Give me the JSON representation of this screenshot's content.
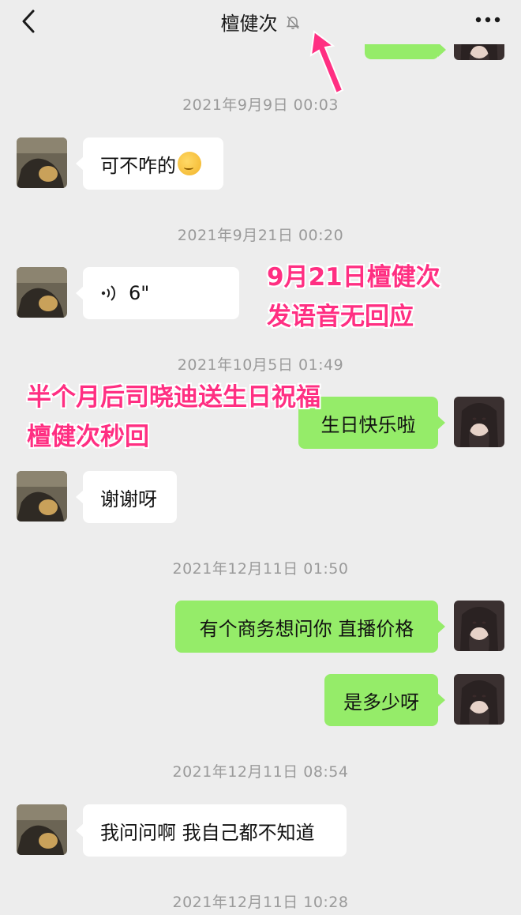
{
  "header": {
    "title": "檀健次",
    "back_icon": "chevron-left-icon",
    "mute_icon": "bell-off-icon",
    "more_icon": "ellipsis-icon"
  },
  "timestamps": [
    "2021年9月9日 00:03",
    "2021年9月21日 00:20",
    "2021年10月5日 01:49",
    "2021年12月11日 01:50",
    "2021年12月11日 08:54",
    "2021年12月11日 10:28"
  ],
  "messages": [
    {
      "from": "contact",
      "text": "可不咋的",
      "emoji": "thinking-face-icon"
    },
    {
      "from": "contact",
      "type": "voice",
      "duration": "6\""
    },
    {
      "from": "me",
      "text": "生日快乐啦"
    },
    {
      "from": "contact",
      "text": "谢谢呀"
    },
    {
      "from": "me",
      "text": "有个商务想问你 直播价格"
    },
    {
      "from": "me",
      "text": "是多少呀"
    },
    {
      "from": "contact",
      "text": "我问问啊 我自己都不知道"
    }
  ],
  "annotations": {
    "voice_note": [
      "9月21日檀健次",
      "发语音无回应"
    ],
    "birthday_note": [
      "半个月后司晓迪送生日祝福",
      "檀健次秒回"
    ]
  },
  "colors": {
    "background": "#ededed",
    "outgoing_bubble": "#95ec69",
    "incoming_bubble": "#ffffff",
    "annotation": "#ff2f82"
  }
}
